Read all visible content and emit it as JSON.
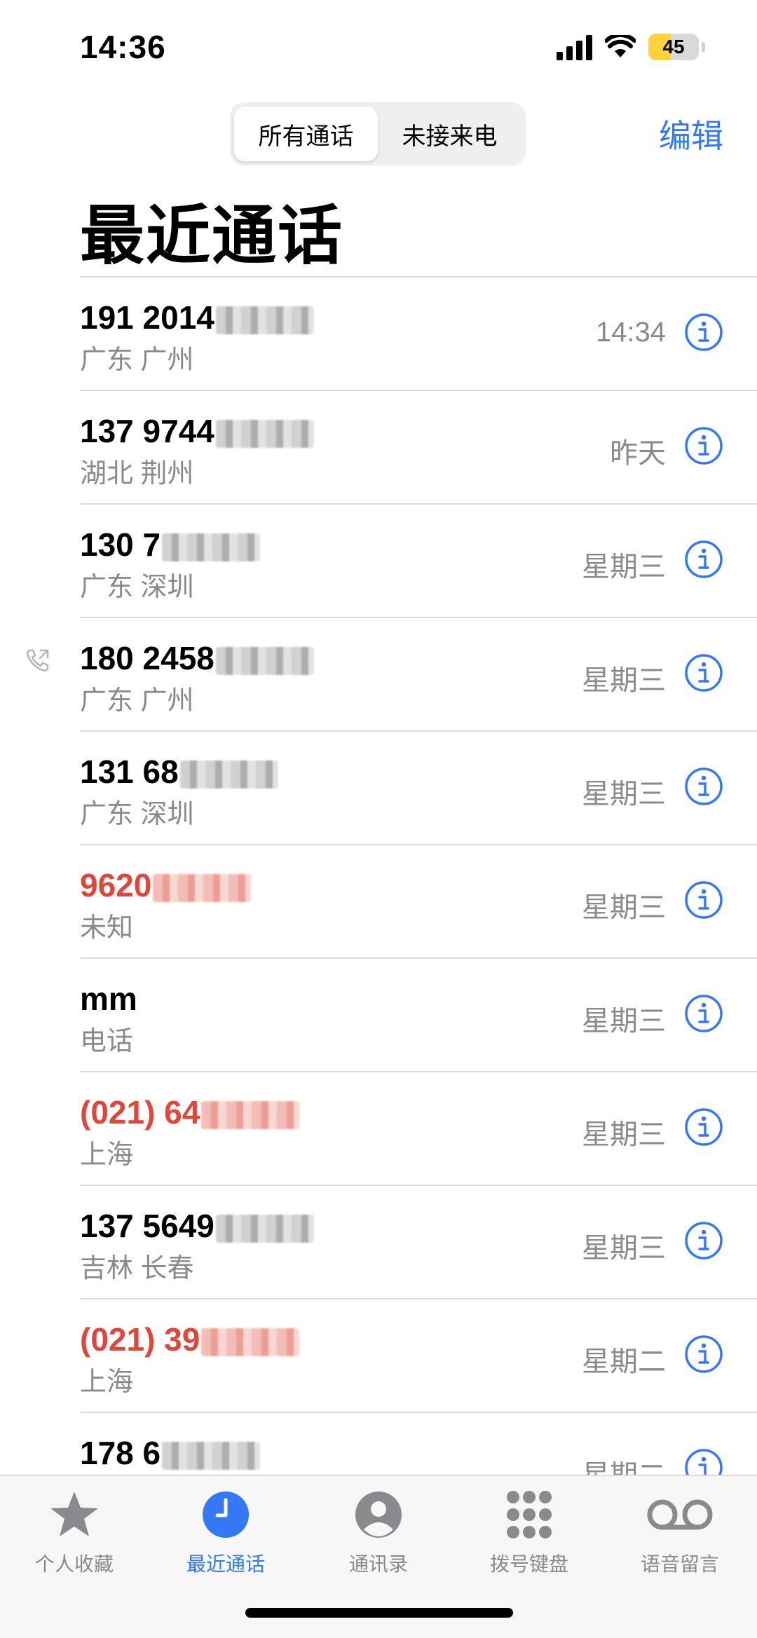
{
  "status": {
    "time": "14:36",
    "battery_level": "45",
    "battery_fraction": 0.45
  },
  "header": {
    "segments": [
      "所有通话",
      "未接来电"
    ],
    "active_segment": 0,
    "edit_label": "编辑",
    "title": "最近通话"
  },
  "calls": [
    {
      "caller": "191 2014",
      "location": "广东 广州",
      "time": "14:34",
      "missed": false,
      "outgoing": false
    },
    {
      "caller": "137 9744",
      "location": "湖北 荆州",
      "time": "昨天",
      "missed": false,
      "outgoing": false
    },
    {
      "caller": "130 7",
      "location": "广东 深圳",
      "time": "星期三",
      "missed": false,
      "outgoing": false
    },
    {
      "caller": "180 2458",
      "location": "广东 广州",
      "time": "星期三",
      "missed": false,
      "outgoing": true
    },
    {
      "caller": "131 68",
      "location": "广东 深圳",
      "time": "星期三",
      "missed": false,
      "outgoing": false
    },
    {
      "caller": "9620",
      "location": "未知",
      "time": "星期三",
      "missed": true,
      "outgoing": false
    },
    {
      "caller": "mm",
      "location": "电话",
      "time": "星期三",
      "missed": false,
      "outgoing": false
    },
    {
      "caller": "(021) 64",
      "location": "上海",
      "time": "星期三",
      "missed": true,
      "outgoing": false
    },
    {
      "caller": "137 5649",
      "location": "吉林 长春",
      "time": "星期三",
      "missed": false,
      "outgoing": false
    },
    {
      "caller": "(021) 39",
      "location": "上海",
      "time": "星期二",
      "missed": true,
      "outgoing": false
    },
    {
      "caller": "178 6",
      "location": "",
      "time": "星期二",
      "missed": false,
      "outgoing": false
    }
  ],
  "tabs": [
    {
      "label": "个人收藏",
      "icon": "star-icon"
    },
    {
      "label": "最近通话",
      "icon": "clock-icon"
    },
    {
      "label": "通讯录",
      "icon": "person-icon"
    },
    {
      "label": "拨号键盘",
      "icon": "keypad-icon"
    },
    {
      "label": "语音留言",
      "icon": "voicemail-icon"
    }
  ],
  "active_tab": 1,
  "colors": {
    "accent": "#3478f6",
    "missed": "#e0463a",
    "secondary_text": "#8a8a8e"
  }
}
